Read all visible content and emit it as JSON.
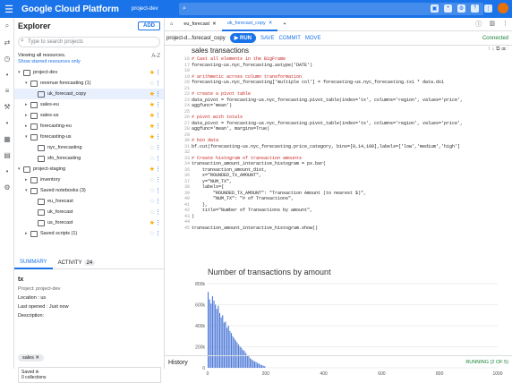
{
  "topbar": {
    "brand": "Google Cloud Platform",
    "project": "project-dev",
    "search_icon": "⌕"
  },
  "explorer": {
    "title": "Explorer",
    "add": "ADD",
    "search_placeholder": "Type to search projects",
    "viewing": "Viewing all resources.",
    "show_starred": "Show starred resources only",
    "sort": "A-Z",
    "tree": [
      {
        "label": "project-dev",
        "level": 0,
        "caret": "▾",
        "starred": true
      },
      {
        "label": "revenue forecasting (1)",
        "level": 1,
        "caret": "▾",
        "starred": false
      },
      {
        "label": "uk_forecast_copy",
        "level": 2,
        "caret": "",
        "starred": true,
        "selected": true
      },
      {
        "label": "sales-eu",
        "level": 1,
        "caret": "▸",
        "starred": true
      },
      {
        "label": "sales-us",
        "level": 1,
        "caret": "▸",
        "starred": true
      },
      {
        "label": "forecasting-eu",
        "level": 1,
        "caret": "▸",
        "starred": true
      },
      {
        "label": "forecasting-us",
        "level": 1,
        "caret": "▾",
        "starred": true
      },
      {
        "label": "nyc_forecasting",
        "level": 2,
        "caret": "",
        "starred": false
      },
      {
        "label": "sfo_forecasting",
        "level": 2,
        "caret": "",
        "starred": false
      },
      {
        "label": "project-staging",
        "level": 0,
        "caret": "▾",
        "starred": true
      },
      {
        "label": "inventory",
        "level": 1,
        "caret": "▸",
        "starred": false
      },
      {
        "label": "Saved notebooks (3)",
        "level": 1,
        "caret": "▾",
        "starred": false
      },
      {
        "label": "eu_forecast",
        "level": 2,
        "caret": "",
        "starred": false
      },
      {
        "label": "uk_forecast",
        "level": 2,
        "caret": "",
        "starred": false
      },
      {
        "label": "us_forecast",
        "level": 2,
        "caret": "",
        "starred": true
      },
      {
        "label": "Saved scripts (1)",
        "level": 1,
        "caret": "▸",
        "starred": false
      }
    ],
    "tabs": {
      "summary": "SUMMARY",
      "activity": "ACTIVITY",
      "activity_count": "24"
    },
    "details": {
      "name": "tx",
      "project": "Project: project-dev",
      "location": "Location : us",
      "last_opened": "Last opened : Just now",
      "description": "Description:"
    },
    "chip": "sales ✕",
    "saved_in_label": "Saved in",
    "saved_in_value": "0 collections"
  },
  "main": {
    "tabs": [
      {
        "label": "eu_forecast",
        "active": false
      },
      {
        "label": "uk_forecast_copy",
        "active": true
      }
    ],
    "toolbar": {
      "notebook": "project-d...forecast_copy",
      "run": "▶ RUN",
      "save": "SAVE",
      "commit": "COMMIT",
      "move": "MOVE",
      "connected": "Connected"
    },
    "title": "sales transactions",
    "lines": [
      {
        "n": "16",
        "t": "# Cast all elements in the BigFrame",
        "c": "cm"
      },
      {
        "n": "17",
        "t": "forecasting-us.nyc_forecasting.astype('DATE')",
        "c": ""
      },
      {
        "n": "18",
        "t": "",
        "c": ""
      },
      {
        "n": "19",
        "t": "# arithmetic across column transformation",
        "c": "cm"
      },
      {
        "n": "20",
        "t": "forecasting-us.nyc_forecasting['multiple col'] = forecasting-us.nyc_forecasting.tx1 * data.dx1",
        "c": ""
      },
      {
        "n": "21",
        "t": "",
        "c": ""
      },
      {
        "n": "22",
        "t": "# create a pivot table",
        "c": "cm"
      },
      {
        "n": "23",
        "t": "data_pivot = forecasting-us.nyc_forecasting.pivot_table(index='tx', columns='region', values='price',",
        "c": ""
      },
      {
        "n": "24",
        "t": "aggfunc='mean')",
        "c": ""
      },
      {
        "n": "25",
        "t": "",
        "c": ""
      },
      {
        "n": "26",
        "t": "# pivot with totals",
        "c": "cm"
      },
      {
        "n": "27",
        "t": "data_pivot = forecasting-us.nyc_forecasting.pivot_table(index='tx', columns='region', values='price',",
        "c": ""
      },
      {
        "n": "28",
        "t": "aggfunc='mean', margins=True)",
        "c": ""
      },
      {
        "n": "29",
        "t": "",
        "c": ""
      },
      {
        "n": "30",
        "t": "# bin data",
        "c": "cm"
      },
      {
        "n": "31",
        "t": "bf.cut(forecasting-us.nyc_forecasting.price_category, bins=[0,14,100],labels=['low','medium','high']",
        "c": ""
      },
      {
        "n": "32",
        "t": "",
        "c": ""
      },
      {
        "n": "33",
        "t": "# Create histogram of transaction amounts",
        "c": "cm"
      },
      {
        "n": "34",
        "t": "transaction_amount_interactive_histogram = px.bar(",
        "c": ""
      },
      {
        "n": "35",
        "t": "    transaction_amount_dist,",
        "c": ""
      },
      {
        "n": "36",
        "t": "    x=\"ROUNDED_TX_AMOUNT\",",
        "c": ""
      },
      {
        "n": "37",
        "t": "    y=\"NUM_TX\",",
        "c": ""
      },
      {
        "n": "38",
        "t": "    labels={",
        "c": ""
      },
      {
        "n": "39",
        "t": "        \"ROUNDED_TX_AMOUNT\": \"Transaction Amount (to nearest $)\",",
        "c": ""
      },
      {
        "n": "40",
        "t": "        \"NUM_TX\": \"# of Transactions\",",
        "c": ""
      },
      {
        "n": "41",
        "t": "    },",
        "c": ""
      },
      {
        "n": "42",
        "t": "    title=\"Number of Transactions by amount\",",
        "c": ""
      },
      {
        "n": "43",
        "t": ")",
        "c": ""
      },
      {
        "n": "44",
        "t": "",
        "c": ""
      },
      {
        "n": "45",
        "t": "transaction_amount_interactive_histogram.show()",
        "c": ""
      }
    ],
    "history": "History",
    "running": "RUNNING (2 OF 5)"
  },
  "chart_data": {
    "type": "bar",
    "title": "Number of transactions by amount",
    "xlabel": "",
    "ylabel": "",
    "x_ticks": [
      "0",
      "200",
      "400",
      "600",
      "800",
      "1000"
    ],
    "y_ticks": [
      "0",
      "200k",
      "400k",
      "600k",
      "800k"
    ],
    "xlim": [
      0,
      1000
    ],
    "ylim": [
      0,
      800000
    ],
    "bar_range": [
      0,
      200
    ],
    "values": [
      720000,
      650000,
      610000,
      680000,
      640000,
      600000,
      560000,
      590000,
      520000,
      480000,
      500000,
      430000,
      440000,
      380000,
      400000,
      350000,
      330000,
      300000,
      280000,
      260000,
      240000,
      220000,
      200000,
      190000,
      170000,
      160000,
      140000,
      120000,
      110000,
      90000,
      80000,
      70000,
      60000,
      55000,
      45000,
      40000,
      30000,
      25000,
      20000,
      15000
    ]
  }
}
